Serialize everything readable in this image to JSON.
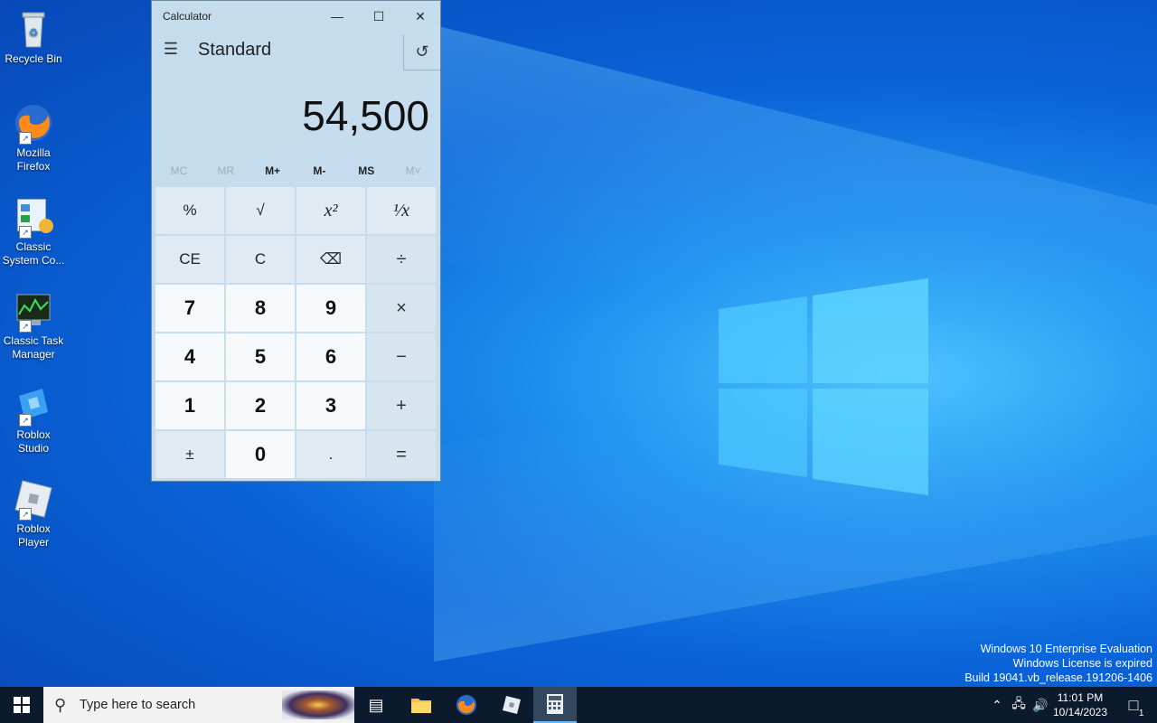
{
  "desktop": {
    "icons": [
      {
        "label": "Recycle Bin"
      },
      {
        "label": "Mozilla Firefox"
      },
      {
        "label": "Classic System Co..."
      },
      {
        "label": "Classic Task Manager"
      },
      {
        "label": "Roblox Studio"
      },
      {
        "label": "Roblox Player"
      }
    ]
  },
  "calculator": {
    "window_title": "Calculator",
    "mode": "Standard",
    "display": "54,500",
    "memory": [
      "MC",
      "MR",
      "M+",
      "M-",
      "MS",
      "M˅"
    ],
    "keys": [
      "%",
      "√",
      "x²",
      "¹⁄x",
      "CE",
      "C",
      "⌫",
      "÷",
      "7",
      "8",
      "9",
      "×",
      "4",
      "5",
      "6",
      "−",
      "1",
      "2",
      "3",
      "+",
      "±",
      "0",
      ".",
      "="
    ]
  },
  "watermark": {
    "line1": "Windows 10 Enterprise Evaluation",
    "line2": "Windows License is expired",
    "line3": "Build 19041.vb_release.191206-1406"
  },
  "taskbar": {
    "search_placeholder": "Type here to search",
    "time": "11:01 PM",
    "date": "10/14/2023",
    "notification_count": "1"
  }
}
